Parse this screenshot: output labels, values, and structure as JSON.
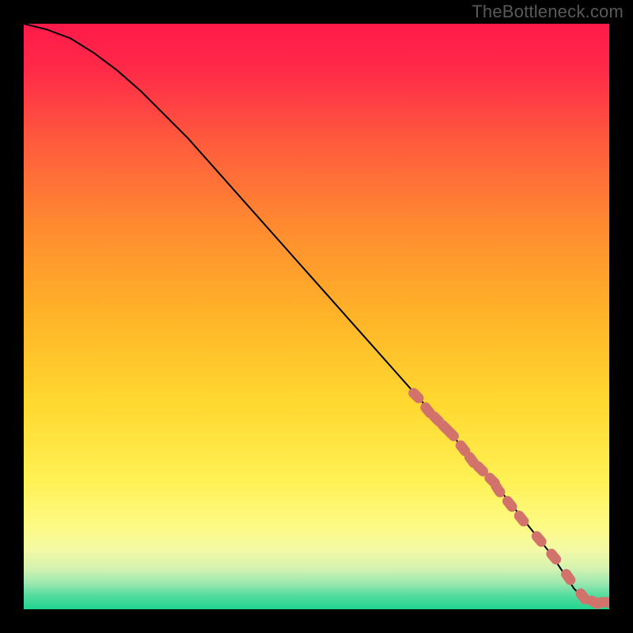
{
  "branding": {
    "watermark": "TheBottleneck.com"
  },
  "chart_data": {
    "type": "line",
    "title": "",
    "xlabel": "",
    "ylabel": "",
    "xlim": [
      0,
      100
    ],
    "ylim": [
      0,
      100
    ],
    "grid": false,
    "legend": false,
    "background": "red-yellow-green-vertical-gradient",
    "series": [
      {
        "name": "bottleneck-curve",
        "type": "line",
        "color": "#000000",
        "x": [
          0,
          4,
          8,
          12,
          16,
          20,
          24,
          28,
          32,
          36,
          40,
          44,
          48,
          52,
          56,
          60,
          64,
          68,
          72,
          76,
          80,
          84,
          86,
          88,
          90,
          92,
          94,
          96,
          98,
          100
        ],
        "y": [
          100,
          99,
          97.5,
          95,
          92,
          88.5,
          84.5,
          80.5,
          76,
          71.5,
          67,
          62.5,
          58,
          53.5,
          49,
          44.5,
          40,
          35.5,
          31,
          26.5,
          22,
          17,
          14.5,
          12,
          9.5,
          6.5,
          3.5,
          1.5,
          1.2,
          1.2
        ]
      },
      {
        "name": "highlight-dots",
        "type": "scatter",
        "color": "#d1736b",
        "shape": "rounded-segments",
        "x": [
          67,
          69,
          70.5,
          72,
          73,
          75,
          76.5,
          78,
          80,
          81,
          83,
          85,
          88,
          90.5,
          93,
          95.5,
          97.5,
          99.2
        ],
        "y": [
          36.5,
          34,
          32.5,
          31,
          30,
          27.5,
          25.5,
          24,
          22,
          20.5,
          18,
          15.5,
          12,
          9,
          5.5,
          2.2,
          1.2,
          1.2
        ]
      }
    ]
  }
}
